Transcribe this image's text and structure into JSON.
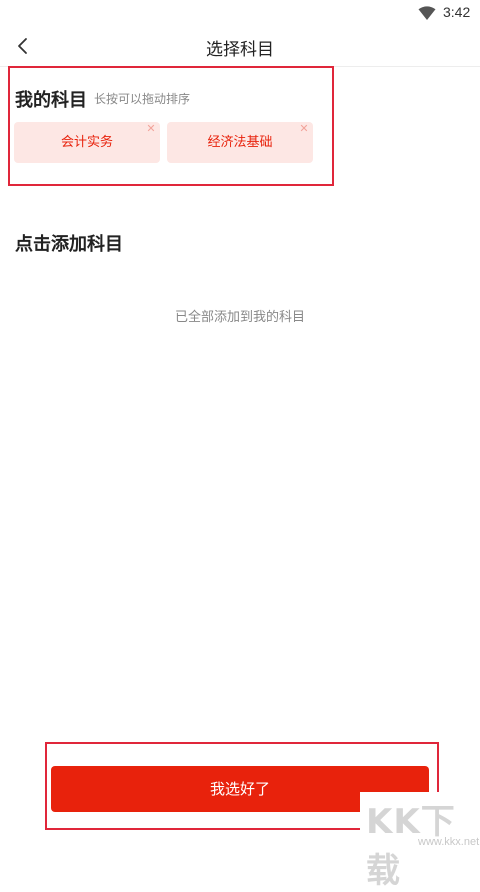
{
  "status_bar": {
    "time": "3:42",
    "wifi_icon": "wifi-icon"
  },
  "nav": {
    "title": "选择科目",
    "back_icon": "chevron-left-icon"
  },
  "my_subjects": {
    "title": "我的科目",
    "hint": "长按可以拖动排序",
    "items": [
      {
        "label": "会计实务",
        "remove_icon": "close-icon"
      },
      {
        "label": "经济法基础",
        "remove_icon": "close-icon"
      }
    ]
  },
  "add_subjects": {
    "title": "点击添加科目",
    "empty_text": "已全部添加到我的科目"
  },
  "confirm_button": {
    "label": "我选好了"
  },
  "watermark": {
    "logo": "KK下载",
    "url": "www.kkx.net"
  },
  "colors": {
    "accent": "#e8220c",
    "chip_background": "#fde7e4",
    "annotation_box": "#e0263a"
  }
}
